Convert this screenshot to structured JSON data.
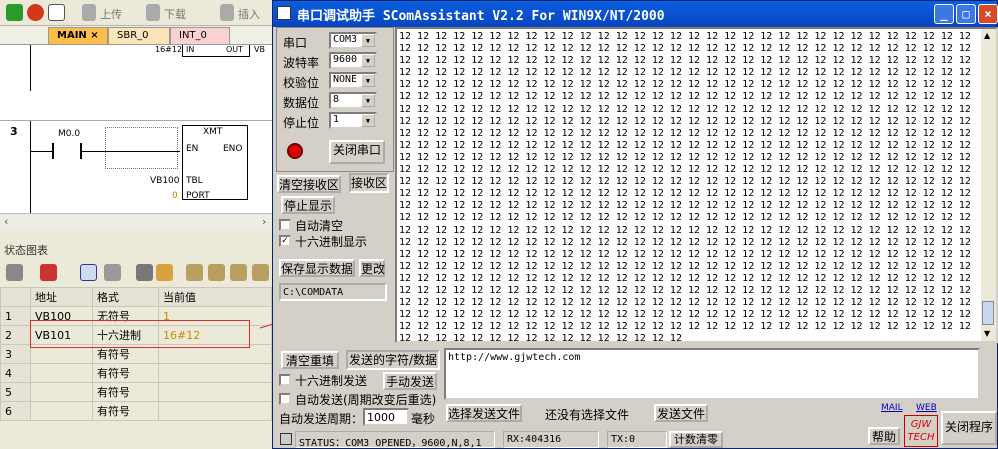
{
  "left": {
    "toolbar": {
      "up": "上传",
      "down": "下载",
      "insert": "插入"
    },
    "tabs": [
      "MAIN",
      "SBR_0",
      "INT_0"
    ],
    "ladder": {
      "prev_block": {
        "in": "IN",
        "out": "OUT",
        "addr": "16#12",
        "side": "VB"
      },
      "network_num": "3",
      "contact": "M0.0",
      "box": "XMT",
      "en": "EN",
      "eno": "ENO",
      "tbl": "TBL",
      "port": "PORT",
      "tbl_val": "VB100",
      "port_val": "0"
    },
    "status_chart": {
      "title": "状态图表",
      "headers": [
        "地址",
        "格式",
        "当前值"
      ],
      "rows": [
        {
          "n": "1",
          "addr": "VB100",
          "fmt": "无符号",
          "val": "1"
        },
        {
          "n": "2",
          "addr": "VB101",
          "fmt": "十六进制",
          "val": "16#12"
        },
        {
          "n": "3",
          "addr": "",
          "fmt": "有符号",
          "val": ""
        },
        {
          "n": "4",
          "addr": "",
          "fmt": "有符号",
          "val": ""
        },
        {
          "n": "5",
          "addr": "",
          "fmt": "有符号",
          "val": ""
        },
        {
          "n": "6",
          "addr": "",
          "fmt": "有符号",
          "val": ""
        }
      ]
    }
  },
  "win": {
    "title": "串口调试助手 SComAssistant V2.2 For WIN9X/NT/2000",
    "labels": {
      "port": "串口",
      "baud": "波特率",
      "parity": "校验位",
      "data": "数据位",
      "stop": "停止位"
    },
    "values": {
      "port": "COM3",
      "baud": "9600",
      "parity": "NONE",
      "data": "8",
      "stop": "1"
    },
    "buttons": {
      "close_port": "关闭串口",
      "clear_recv": "清空接收区",
      "recv_area": "接收区",
      "stop_show": "停止显示",
      "save": "保存显示数据",
      "change": "更改",
      "clear_resend": "清空重填",
      "send_area": "发送的字符/数据",
      "manual_send": "手动发送",
      "select_file": "选择发送文件",
      "send_file": "发送文件",
      "help": "帮助",
      "close_prog": "关闭程序",
      "count_clear": "计数清零"
    },
    "checks": {
      "auto_clear": "自动清空",
      "hex_show": "十六进制显示",
      "hex_send": "十六进制发送",
      "auto_send": "自动发送(周期改变后重选)"
    },
    "period_label": "自动发送周期：",
    "period_value": "1000",
    "ms": "毫秒",
    "path": "C:\\COMDATA",
    "no_file": "还没有选择文件",
    "send_text": "http://www.gjwtech.com",
    "mail": "MAIL",
    "web": "WEB",
    "logo": "GJW TECH",
    "status": {
      "st": "STATUS：COM3 OPENED，9600,N,8,1",
      "rx": "RX:404316",
      "tx": "TX:0"
    },
    "recv_token": "12"
  }
}
